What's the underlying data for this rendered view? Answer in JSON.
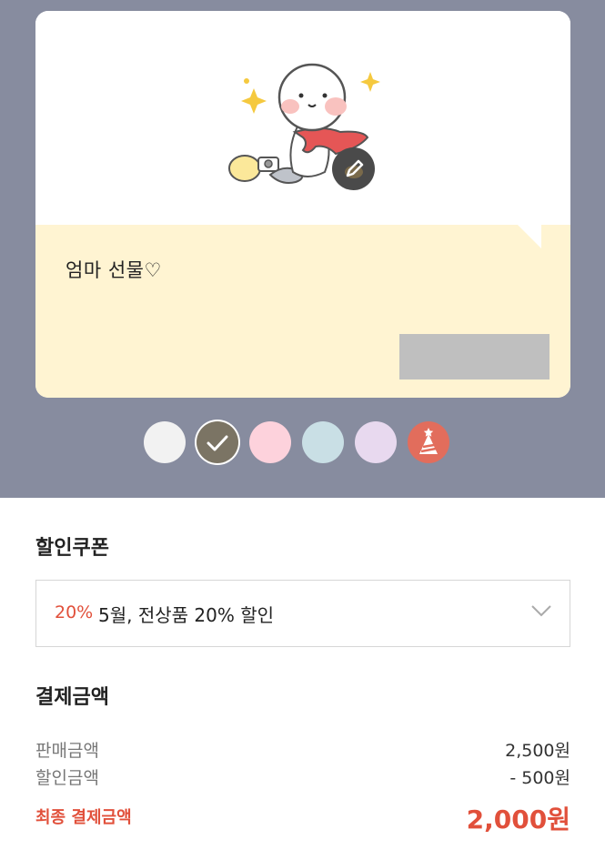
{
  "card": {
    "message": "엄마 선물♡",
    "illustration_icon": "dancing-character-illustration",
    "edit_icon": "pencil-icon"
  },
  "swatches": [
    {
      "name": "white",
      "color": "#f2f2f2",
      "selected": false
    },
    {
      "name": "olive-brown",
      "color": "#7b7464",
      "selected": true
    },
    {
      "name": "pink",
      "color": "#fdd2dc",
      "selected": false
    },
    {
      "name": "light-blue",
      "color": "#c9dfe5",
      "selected": false
    },
    {
      "name": "lavender",
      "color": "#e8d9ef",
      "selected": false
    },
    {
      "name": "party",
      "color": "#e26d5c",
      "selected": false,
      "icon": "party-hat-icon"
    }
  ],
  "coupon": {
    "title": "할인쿠폰",
    "percent": "20%",
    "name": "5월, 전상품 20% 할인"
  },
  "payment": {
    "title": "결제금액",
    "sale_label": "판매금액",
    "sale_value": "2,500원",
    "discount_label": "할인금액",
    "discount_value": "- 500원",
    "final_label": "최종 결제금액",
    "final_value": "2,000원"
  },
  "colors": {
    "background_top": "#878c9f",
    "message_bg": "#fff4d2",
    "accent_red": "#e1503b"
  }
}
